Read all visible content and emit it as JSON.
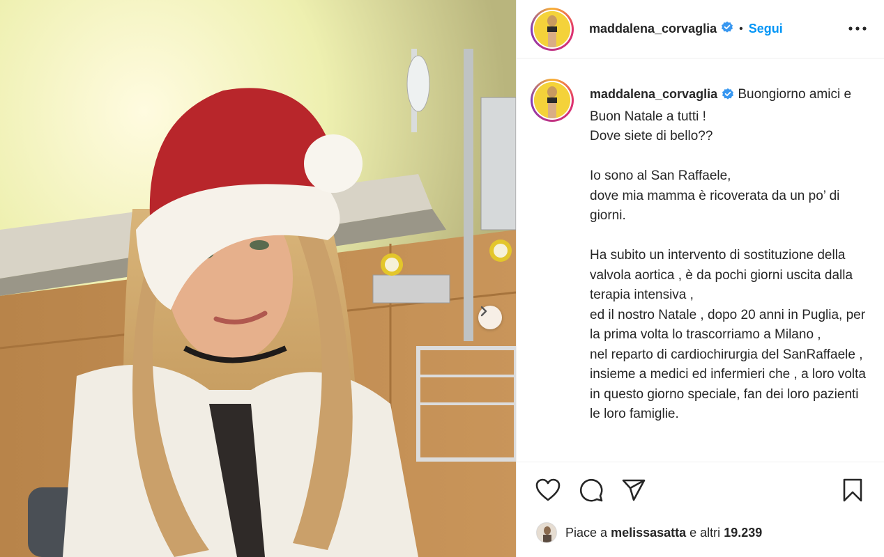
{
  "post": {
    "username": "maddalena_corvaglia",
    "separator": "•",
    "follow_label": "Segui",
    "caption_intro": "Buongiorno amici e Buon Natale a tutti !\nDove siete di bello??\n\nIo sono al San Raffaele,\ndove mia mamma è ricoverata da un po’ di giorni.\n\nHa subito un intervento di sostituzione della valvola aortica , è da pochi giorni uscita dalla terapia intensiva ,\ned il nostro Natale , dopo 20 anni in Puglia, per la prima volta lo trascorriamo a Milano ,\nnel reparto di cardiochirurgia del SanRaffaele , insieme a medici ed infermieri che , a loro volta in questo giorno speciale, fan dei loro pazienti le loro famiglie."
  },
  "likes": {
    "prefix": "Piace a",
    "user": "melissasatta",
    "conjunction": "e altri",
    "count": "19.239"
  },
  "icons": {
    "verified": "verified-badge-icon",
    "more": "more-options-icon",
    "like": "heart-icon",
    "comment": "comment-bubble-icon",
    "share": "paper-plane-icon",
    "save": "bookmark-icon",
    "next": "chevron-right-icon"
  },
  "colors": {
    "accent": "#0095f6",
    "text": "#262626",
    "divider": "#efefef"
  }
}
